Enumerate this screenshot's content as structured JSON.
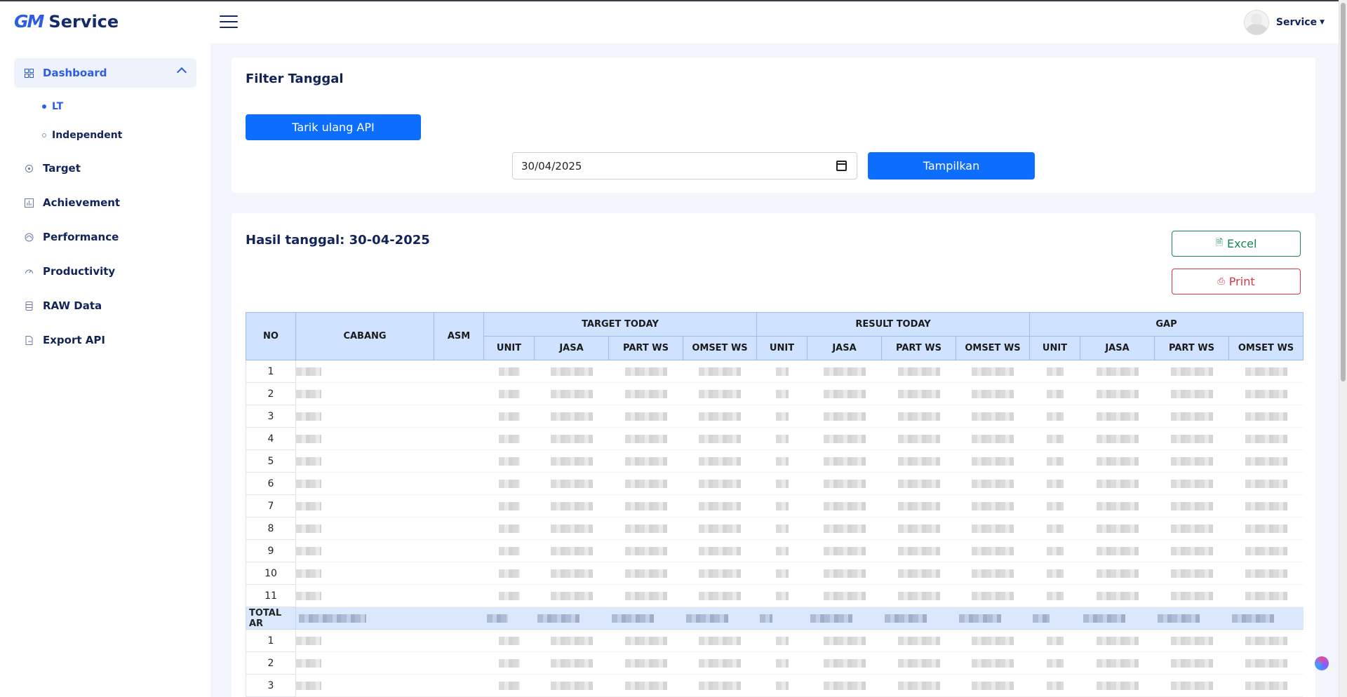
{
  "header": {
    "brand_logo": "GM",
    "brand_name": "Service",
    "user_name": "Service"
  },
  "sidebar": {
    "items": [
      {
        "label": "Dashboard",
        "icon": "grid-icon",
        "active": true
      },
      {
        "label": "Target",
        "icon": "target-icon"
      },
      {
        "label": "Achievement",
        "icon": "bar-chart-icon"
      },
      {
        "label": "Performance",
        "icon": "gauge-icon"
      },
      {
        "label": "Productivity",
        "icon": "speedometer-icon"
      },
      {
        "label": "RAW Data",
        "icon": "database-icon"
      },
      {
        "label": "Export API",
        "icon": "file-export-icon"
      }
    ],
    "sub_items": [
      {
        "label": "LT",
        "active": true
      },
      {
        "label": "Independent"
      }
    ]
  },
  "filter": {
    "title": "Filter Tanggal",
    "reload_button": "Tarik ulang API",
    "date_value": "30/04/2025",
    "show_button": "Tampilkan"
  },
  "result": {
    "title": "Hasil tanggal: 30-04-2025",
    "excel_button": "Excel",
    "print_button": "Print",
    "table": {
      "headers": {
        "no": "NO",
        "cabang": "CABANG",
        "asm": "ASM",
        "groups": [
          "TARGET TODAY",
          "RESULT TODAY",
          "GAP"
        ],
        "sub": [
          "UNIT",
          "JASA",
          "PART WS",
          "OMSET WS"
        ]
      },
      "rows_group1": [
        "1",
        "2",
        "3",
        "4",
        "5",
        "6",
        "7",
        "8",
        "9",
        "10",
        "11"
      ],
      "total_label": "TOTAL AR",
      "rows_group2": [
        "1",
        "2",
        "3"
      ]
    }
  },
  "colors": {
    "primary": "#0d6efd",
    "brand": "#2d5de0",
    "excel": "#198754",
    "print": "#dc3545",
    "table_header": "#cfe2ff"
  }
}
